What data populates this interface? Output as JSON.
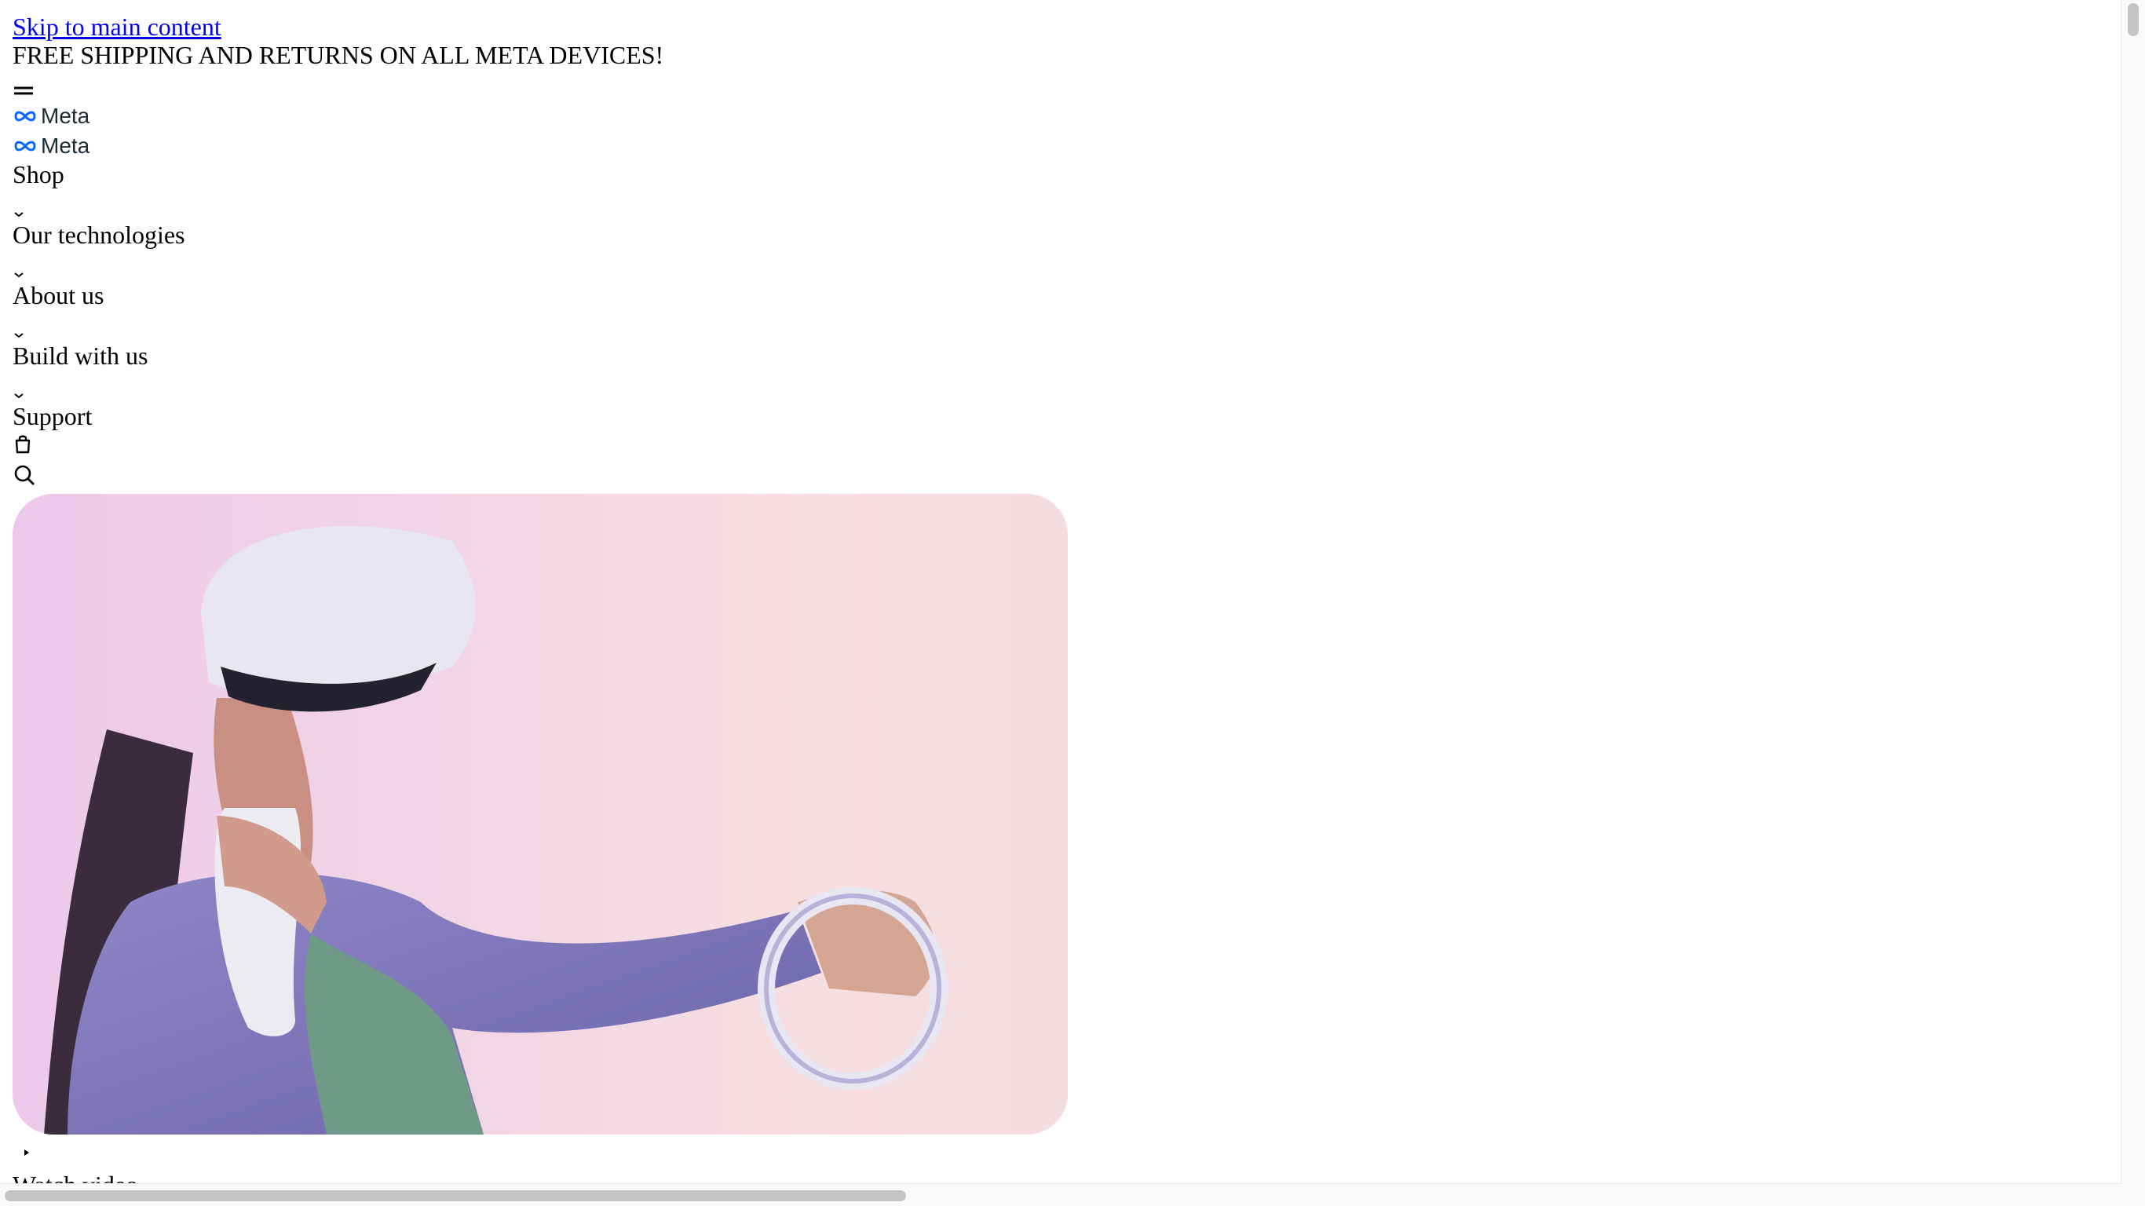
{
  "skip_link": "Skip to main content",
  "banner": "FREE SHIPPING AND RETURNS ON ALL META DEVICES!",
  "logo_text": "Meta",
  "nav": {
    "items": [
      {
        "label": "Shop"
      },
      {
        "label": "Our technologies"
      },
      {
        "label": "About us"
      },
      {
        "label": "Build with us"
      },
      {
        "label": "Support"
      }
    ]
  },
  "icons": {
    "menu": "menu-icon",
    "chevron": "chevron-down-icon",
    "bag": "shopping-bag-icon",
    "search": "search-icon",
    "play": "play-triangle-icon"
  },
  "hero": {
    "image": "person-in-vr-headset-with-controllers"
  },
  "bottom_clipped_text": "Watch video",
  "colors": {
    "link": "#0000ee",
    "meta_blue": "#0866ff",
    "logo_text": "#1c2b33",
    "hero_gradient_left": "#edc8ea",
    "hero_gradient_right": "#f4dde0"
  }
}
